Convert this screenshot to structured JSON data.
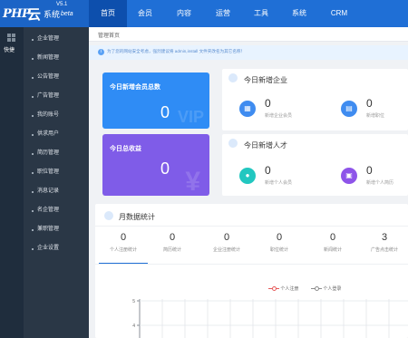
{
  "app": {
    "logo": {
      "php": "PHP",
      "cloud": "云",
      "system": "系统",
      "version": "V5.1",
      "beta": "beta"
    }
  },
  "topnav": {
    "items": [
      {
        "label": "首页",
        "active": true
      },
      {
        "label": "会员",
        "active": false
      },
      {
        "label": "内容",
        "active": false
      },
      {
        "label": "运营",
        "active": false
      },
      {
        "label": "工具",
        "active": false
      },
      {
        "label": "系统",
        "active": false
      },
      {
        "label": "CRM",
        "active": false
      }
    ]
  },
  "rail": {
    "label": "快捷",
    "icon": "grid-icon"
  },
  "sidebar": {
    "items": [
      {
        "label": "企业管理"
      },
      {
        "label": "新闻管理"
      },
      {
        "label": "公告管理"
      },
      {
        "label": "广告管理"
      },
      {
        "label": "我的账号"
      },
      {
        "label": "供求用户"
      },
      {
        "label": "简历管理"
      },
      {
        "label": "职位管理"
      },
      {
        "label": "消息记录"
      },
      {
        "label": "名企管理"
      },
      {
        "label": "兼职管理"
      },
      {
        "label": "企业设置"
      }
    ]
  },
  "breadcrumb": "管理首页",
  "notice": {
    "icon": "info-icon",
    "text": "为了您的网站安全考虑，强烈建议将 admin,install 文件夹改名为其它名称！"
  },
  "cards": {
    "members_today": {
      "title": "今日新增会员总数",
      "value": "0",
      "watermark": "VIP",
      "color": "#2f8cf5"
    },
    "revenue_today": {
      "title": "今日总收益",
      "value": "0",
      "watermark": "¥",
      "color": "#7f5ce8"
    }
  },
  "enterprise_panel": {
    "title": "今日新增企业",
    "items": [
      {
        "icon": "building-icon",
        "value": "0",
        "label": "新增企业会员",
        "color": "#3f8cf0"
      },
      {
        "icon": "briefcase-icon",
        "value": "0",
        "label": "新增职位",
        "color": "#3f8cf0"
      }
    ]
  },
  "talent_panel": {
    "title": "今日新增人才",
    "items": [
      {
        "icon": "user-icon",
        "value": "0",
        "label": "新增个人会员",
        "color": "#22c7c0"
      },
      {
        "icon": "resume-icon",
        "value": "0",
        "label": "新增个人简历",
        "color": "#8e54e9"
      }
    ]
  },
  "monthly": {
    "title": "月数据统计",
    "metrics": [
      {
        "value": "0",
        "label": "个人注册统计"
      },
      {
        "value": "0",
        "label": "简历统计"
      },
      {
        "value": "0",
        "label": "企业注册统计"
      },
      {
        "value": "0",
        "label": "职位统计"
      },
      {
        "value": "0",
        "label": "新闻统计"
      },
      {
        "value": "3",
        "label": "广告点击统计"
      }
    ]
  },
  "chart_data": {
    "type": "line",
    "series": [
      {
        "name": "个人注册",
        "color": "#e65a5a",
        "values": []
      },
      {
        "name": "个人登录",
        "color": "#8c8c8c",
        "values": []
      }
    ],
    "y_ticks": [
      "5",
      "4"
    ],
    "grid": true
  }
}
